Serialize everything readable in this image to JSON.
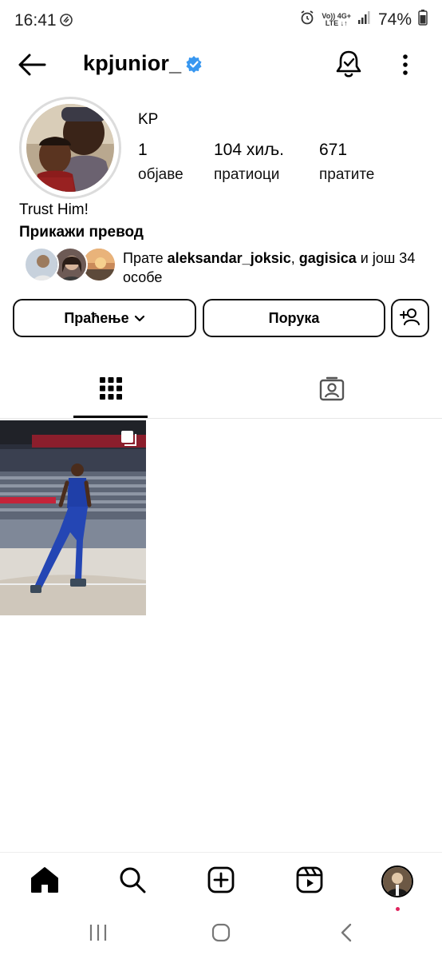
{
  "status_bar": {
    "time": "16:41",
    "network_top": "Vo)) 4G+",
    "network_bottom": "LTE ↓↑",
    "battery": "74%",
    "icons": [
      "data-saver-icon",
      "alarm-icon",
      "signal-icon",
      "battery-icon"
    ]
  },
  "header": {
    "username": "kpjunior_",
    "verified": true,
    "icons": [
      "back-arrow-icon",
      "verified-badge-icon",
      "notification-bell-icon",
      "more-options-icon"
    ]
  },
  "profile": {
    "display_name": "KP",
    "stats": [
      {
        "value": "1",
        "label": "објаве"
      },
      {
        "value": "104 хиљ.",
        "label": "пратиоци"
      },
      {
        "value": "671",
        "label": "пратите"
      }
    ],
    "bio": "Trust Him!",
    "translate_label": "Прикажи превод",
    "followed_by": {
      "prefix": "Прате ",
      "user1": "aleksandar_joksic",
      "separator": ", ",
      "user2": "gagisica",
      "suffix": " и још 34 особе"
    }
  },
  "actions": {
    "follow_label": "Праћење",
    "message_label": "Порука",
    "suggest_icon": "add-person-icon"
  },
  "tabs": [
    {
      "name": "grid",
      "icon": "grid-icon",
      "active": true
    },
    {
      "name": "tagged",
      "icon": "tagged-person-icon",
      "active": false
    }
  ],
  "posts": [
    {
      "type": "carousel",
      "icon": "multiple-posts-icon"
    }
  ],
  "bottom_nav": {
    "icons": [
      "home-icon",
      "search-icon",
      "create-icon",
      "reels-icon",
      "profile-avatar"
    ]
  },
  "colors": {
    "verified": "#3897f0",
    "notification_dot": "#e0245e",
    "text": "#000000",
    "border": "#dbdbdb"
  }
}
